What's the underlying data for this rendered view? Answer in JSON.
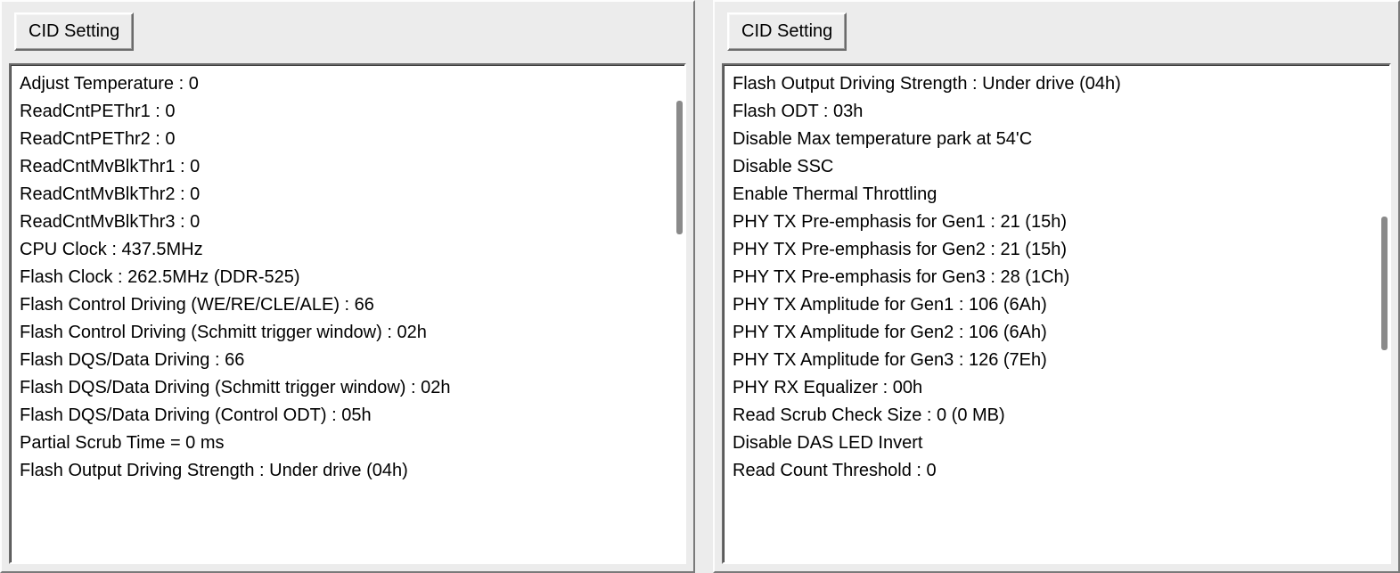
{
  "left": {
    "button_label": "CID Setting",
    "items": [
      "Adjust Temperature : 0",
      "ReadCntPEThr1 : 0",
      "ReadCntPEThr2 : 0",
      "ReadCntMvBlkThr1 : 0",
      "ReadCntMvBlkThr2 : 0",
      "ReadCntMvBlkThr3 : 0",
      "CPU Clock : 437.5MHz",
      "Flash Clock : 262.5MHz (DDR-525)",
      "Flash Control Driving (WE/RE/CLE/ALE) : 66",
      "Flash Control Driving (Schmitt trigger window) : 02h",
      "Flash DQS/Data Driving : 66",
      "Flash DQS/Data Driving (Schmitt trigger window) : 02h",
      "Flash DQS/Data Driving (Control ODT) : 05h",
      "Partial Scrub Time = 0 ms",
      "Flash Output Driving Strength : Under drive (04h)"
    ]
  },
  "right": {
    "button_label": "CID Setting",
    "items": [
      "Flash Output Driving Strength : Under drive (04h)",
      "Flash ODT : 03h",
      "Disable Max temperature park at 54'C",
      "Disable SSC",
      "Enable Thermal Throttling",
      "PHY TX Pre-emphasis for Gen1 : 21 (15h)",
      "PHY TX Pre-emphasis for Gen2 : 21 (15h)",
      "PHY TX Pre-emphasis for Gen3 : 28 (1Ch)",
      "PHY TX Amplitude for Gen1 : 106 (6Ah)",
      "PHY TX Amplitude for Gen2 : 106 (6Ah)",
      "PHY TX Amplitude for Gen3 : 126 (7Eh)",
      "PHY RX Equalizer : 00h",
      "Read Scrub Check Size : 0 (0 MB)",
      "Disable DAS LED Invert",
      "Read Count Threshold : 0"
    ]
  }
}
